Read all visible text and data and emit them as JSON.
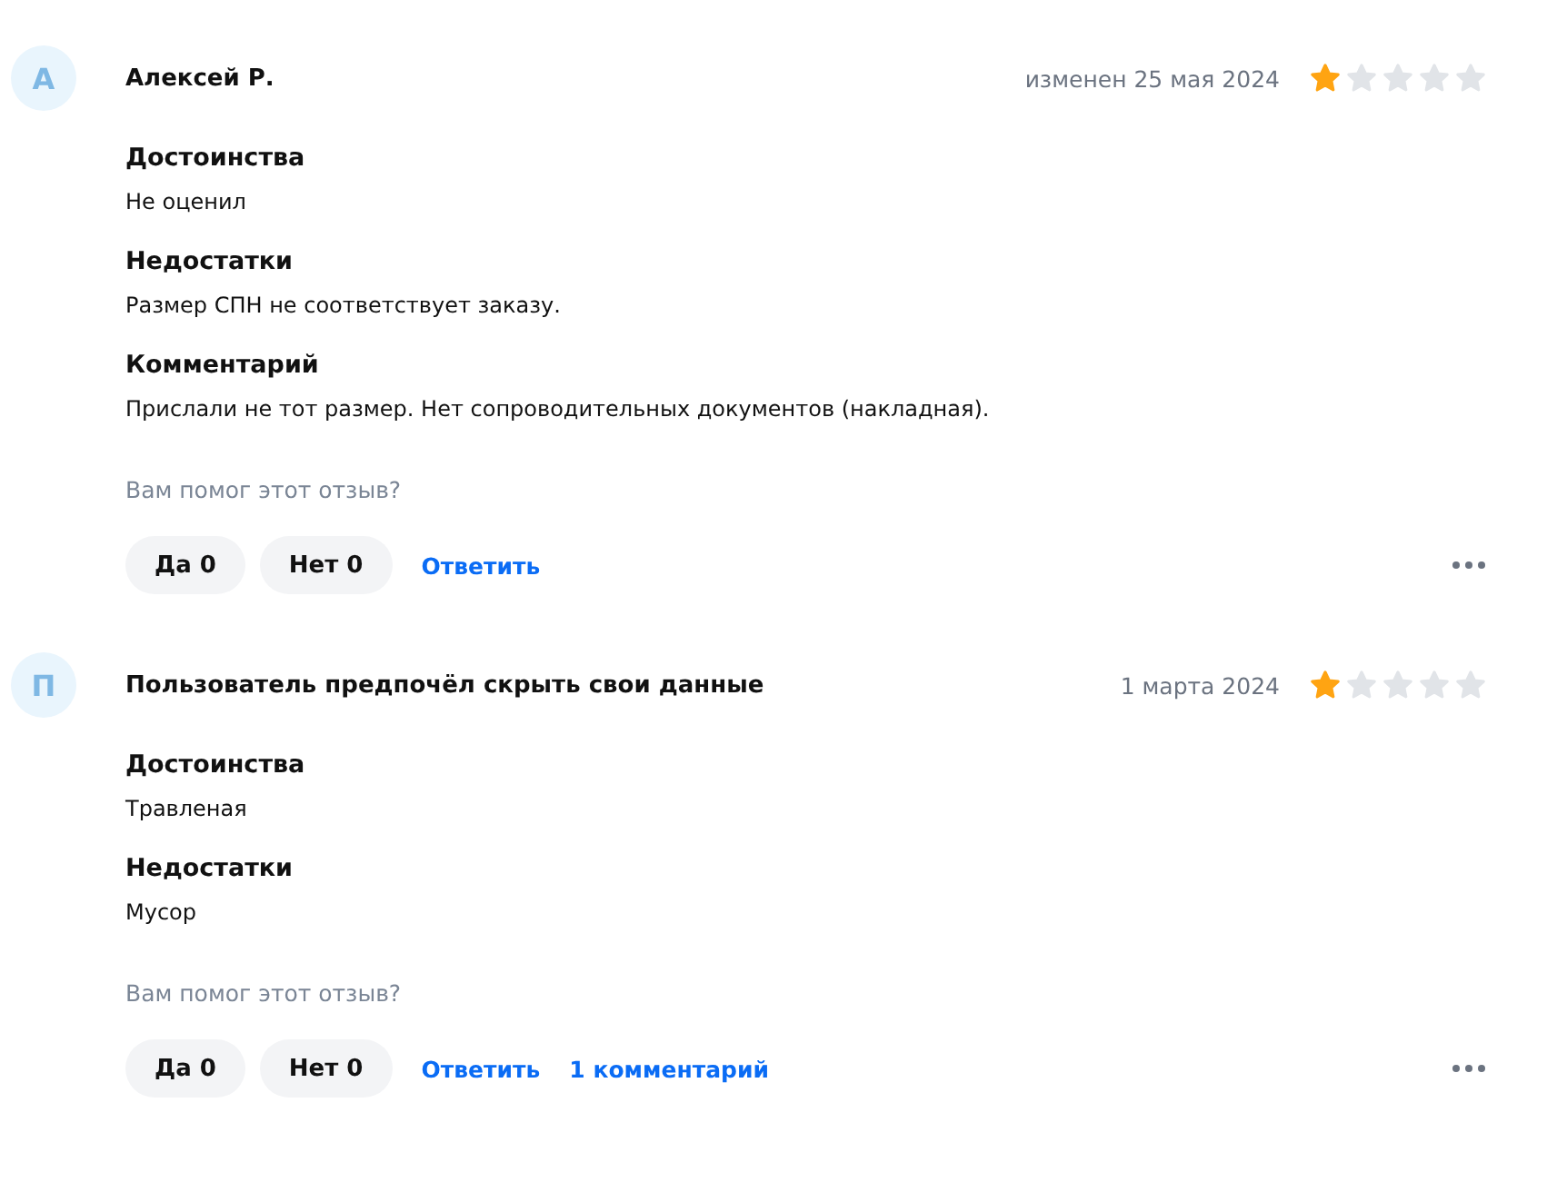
{
  "reviews": [
    {
      "avatar": "А",
      "author": "Алексей Р.",
      "date": "изменен 25 мая 2024",
      "stars": 1,
      "sections": [
        {
          "title": "Достоинства",
          "text": "Не оценил"
        },
        {
          "title": "Недостатки",
          "text": "Размер СПН не соответствует заказу."
        },
        {
          "title": "Комментарий",
          "text": "Прислали не тот размер. Нет сопроводительных документов (накладная)."
        }
      ],
      "helpful_prompt": "Вам помог этот отзыв?",
      "yes": "Да 0",
      "no": "Нет 0",
      "links": [
        "Ответить"
      ]
    },
    {
      "avatar": "П",
      "author": "Пользователь предпочёл скрыть свои данные",
      "date": "1 марта 2024",
      "stars": 1,
      "sections": [
        {
          "title": "Достоинства",
          "text": "Травленая"
        },
        {
          "title": "Недостатки",
          "text": "Мусор"
        }
      ],
      "helpful_prompt": "Вам помог этот отзыв?",
      "yes": "Да 0",
      "no": "Нет 0",
      "links": [
        "Ответить",
        "1 комментарий"
      ]
    }
  ]
}
